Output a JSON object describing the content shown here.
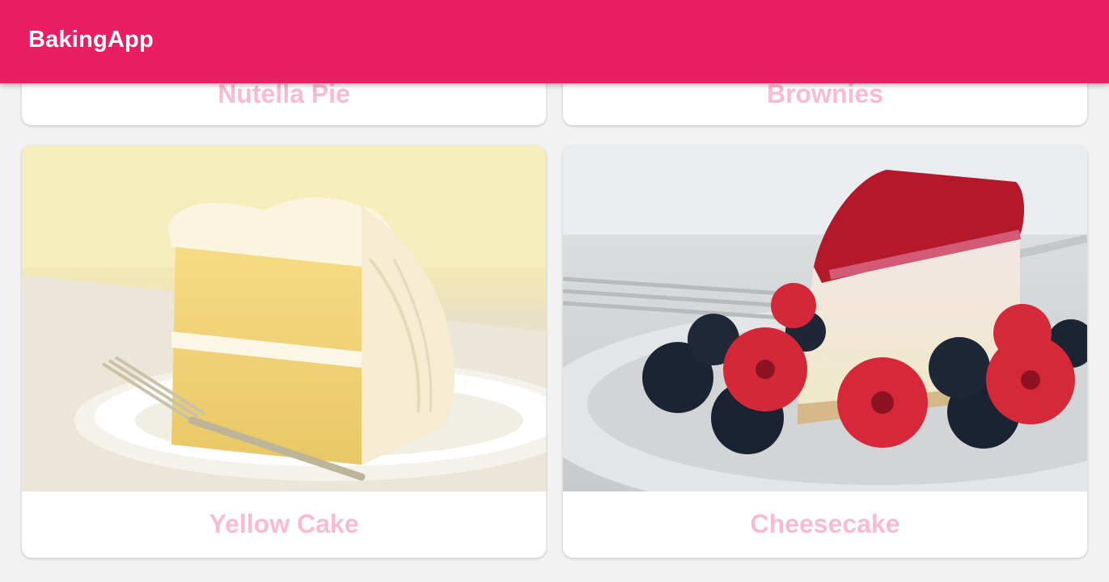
{
  "app_bar": {
    "title": "BakingApp",
    "color": "#e91e63"
  },
  "recipes": [
    {
      "name": "Nutella Pie",
      "image": "none"
    },
    {
      "name": "Brownies",
      "image": "none"
    },
    {
      "name": "Yellow Cake",
      "image": "yellow-cake-photo"
    },
    {
      "name": "Cheesecake",
      "image": "cheesecake-photo"
    }
  ],
  "colors": {
    "label": "#f8bbd0",
    "card": "#ffffff",
    "background": "#f2f2f2"
  }
}
